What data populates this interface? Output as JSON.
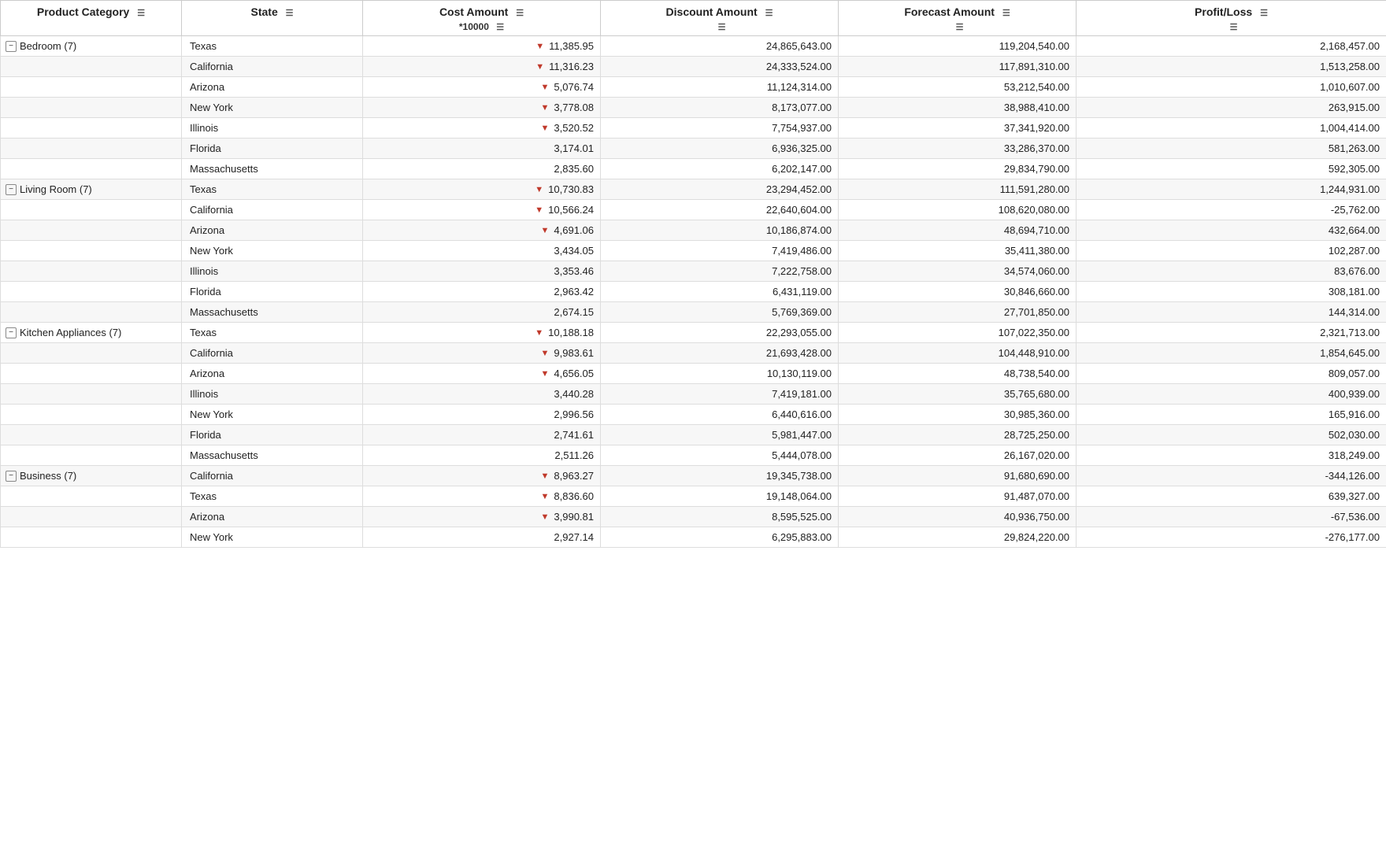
{
  "headers": {
    "row1": [
      "Product Category",
      "State",
      "Cost Amount",
      "Discount Amount",
      "Forecast Amount",
      "Profit/Loss"
    ],
    "row2": [
      "",
      "",
      "*10000",
      "",
      "",
      ""
    ]
  },
  "categories": [
    {
      "name": "Bedroom (7)",
      "rows": [
        {
          "state": "Texas",
          "cost": "11,385.95",
          "discount": "24,865,643.00",
          "forecast": "119,204,540.00",
          "profit": "2,168,457.00",
          "costArrow": true
        },
        {
          "state": "California",
          "cost": "11,316.23",
          "discount": "24,333,524.00",
          "forecast": "117,891,310.00",
          "profit": "1,513,258.00",
          "costArrow": true
        },
        {
          "state": "Arizona",
          "cost": "5,076.74",
          "discount": "11,124,314.00",
          "forecast": "53,212,540.00",
          "profit": "1,010,607.00",
          "costArrow": true
        },
        {
          "state": "New York",
          "cost": "3,778.08",
          "discount": "8,173,077.00",
          "forecast": "38,988,410.00",
          "profit": "263,915.00",
          "costArrow": true
        },
        {
          "state": "Illinois",
          "cost": "3,520.52",
          "discount": "7,754,937.00",
          "forecast": "37,341,920.00",
          "profit": "1,004,414.00",
          "costArrow": true
        },
        {
          "state": "Florida",
          "cost": "3,174.01",
          "discount": "6,936,325.00",
          "forecast": "33,286,370.00",
          "profit": "581,263.00",
          "costArrow": false
        },
        {
          "state": "Massachusetts",
          "cost": "2,835.60",
          "discount": "6,202,147.00",
          "forecast": "29,834,790.00",
          "profit": "592,305.00",
          "costArrow": false
        }
      ]
    },
    {
      "name": "Living Room (7)",
      "rows": [
        {
          "state": "Texas",
          "cost": "10,730.83",
          "discount": "23,294,452.00",
          "forecast": "111,591,280.00",
          "profit": "1,244,931.00",
          "costArrow": true
        },
        {
          "state": "California",
          "cost": "10,566.24",
          "discount": "22,640,604.00",
          "forecast": "108,620,080.00",
          "profit": "-25,762.00",
          "costArrow": true
        },
        {
          "state": "Arizona",
          "cost": "4,691.06",
          "discount": "10,186,874.00",
          "forecast": "48,694,710.00",
          "profit": "432,664.00",
          "costArrow": true
        },
        {
          "state": "New York",
          "cost": "3,434.05",
          "discount": "7,419,486.00",
          "forecast": "35,411,380.00",
          "profit": "102,287.00",
          "costArrow": false
        },
        {
          "state": "Illinois",
          "cost": "3,353.46",
          "discount": "7,222,758.00",
          "forecast": "34,574,060.00",
          "profit": "83,676.00",
          "costArrow": false
        },
        {
          "state": "Florida",
          "cost": "2,963.42",
          "discount": "6,431,119.00",
          "forecast": "30,846,660.00",
          "profit": "308,181.00",
          "costArrow": false
        },
        {
          "state": "Massachusetts",
          "cost": "2,674.15",
          "discount": "5,769,369.00",
          "forecast": "27,701,850.00",
          "profit": "144,314.00",
          "costArrow": false
        }
      ]
    },
    {
      "name": "Kitchen Appliances (7)",
      "rows": [
        {
          "state": "Texas",
          "cost": "10,188.18",
          "discount": "22,293,055.00",
          "forecast": "107,022,350.00",
          "profit": "2,321,713.00",
          "costArrow": true
        },
        {
          "state": "California",
          "cost": "9,983.61",
          "discount": "21,693,428.00",
          "forecast": "104,448,910.00",
          "profit": "1,854,645.00",
          "costArrow": true
        },
        {
          "state": "Arizona",
          "cost": "4,656.05",
          "discount": "10,130,119.00",
          "forecast": "48,738,540.00",
          "profit": "809,057.00",
          "costArrow": true
        },
        {
          "state": "Illinois",
          "cost": "3,440.28",
          "discount": "7,419,181.00",
          "forecast": "35,765,680.00",
          "profit": "400,939.00",
          "costArrow": false
        },
        {
          "state": "New York",
          "cost": "2,996.56",
          "discount": "6,440,616.00",
          "forecast": "30,985,360.00",
          "profit": "165,916.00",
          "costArrow": false
        },
        {
          "state": "Florida",
          "cost": "2,741.61",
          "discount": "5,981,447.00",
          "forecast": "28,725,250.00",
          "profit": "502,030.00",
          "costArrow": false
        },
        {
          "state": "Massachusetts",
          "cost": "2,511.26",
          "discount": "5,444,078.00",
          "forecast": "26,167,020.00",
          "profit": "318,249.00",
          "costArrow": false
        }
      ]
    },
    {
      "name": "Business (7)",
      "rows": [
        {
          "state": "California",
          "cost": "8,963.27",
          "discount": "19,345,738.00",
          "forecast": "91,680,690.00",
          "profit": "-344,126.00",
          "costArrow": true
        },
        {
          "state": "Texas",
          "cost": "8,836.60",
          "discount": "19,148,064.00",
          "forecast": "91,487,070.00",
          "profit": "639,327.00",
          "costArrow": true
        },
        {
          "state": "Arizona",
          "cost": "3,990.81",
          "discount": "8,595,525.00",
          "forecast": "40,936,750.00",
          "profit": "-67,536.00",
          "costArrow": true
        },
        {
          "state": "New York",
          "cost": "2,927.14",
          "discount": "6,295,883.00",
          "forecast": "29,824,220.00",
          "profit": "-276,177.00",
          "costArrow": false
        }
      ]
    }
  ]
}
